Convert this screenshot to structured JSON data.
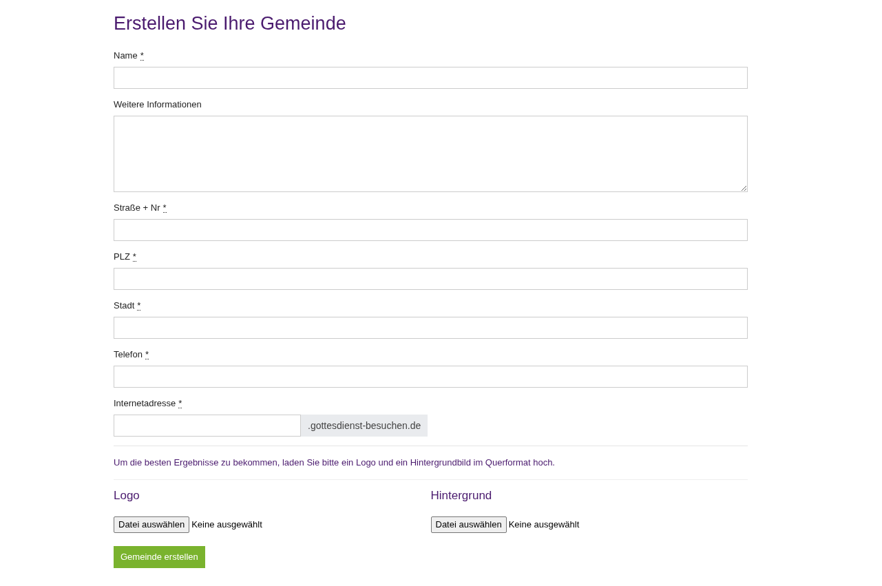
{
  "title": "Erstellen Sie Ihre Gemeinde",
  "fields": [
    {
      "kind": "input",
      "label": "Name",
      "required_mark": "*"
    },
    {
      "kind": "textarea",
      "label": "Weitere Informationen"
    },
    {
      "kind": "input",
      "label": "Straße + Nr",
      "required_mark": "*"
    },
    {
      "kind": "input",
      "label": "PLZ",
      "required_mark": "*"
    },
    {
      "kind": "input",
      "label": "Stadt",
      "required_mark": "*"
    },
    {
      "kind": "input",
      "label": "Telefon",
      "required_mark": "*"
    },
    {
      "kind": "addon",
      "label": "Internetadresse",
      "required_mark": "*",
      "addon": ".gottesdienst-besuchen.de"
    }
  ],
  "notice": "Um die besten Ergebnisse zu bekommen, laden Sie bitte ein Logo und ein Hintergrundbild im Querformat hoch.",
  "uploads": [
    {
      "heading": "Logo",
      "button": "Datei auswählen",
      "status": "Keine ausgewählt"
    },
    {
      "heading": "Hintergrund",
      "button": "Datei auswählen",
      "status": "Keine ausgewählt"
    }
  ],
  "submit": "Gemeinde erstellen"
}
